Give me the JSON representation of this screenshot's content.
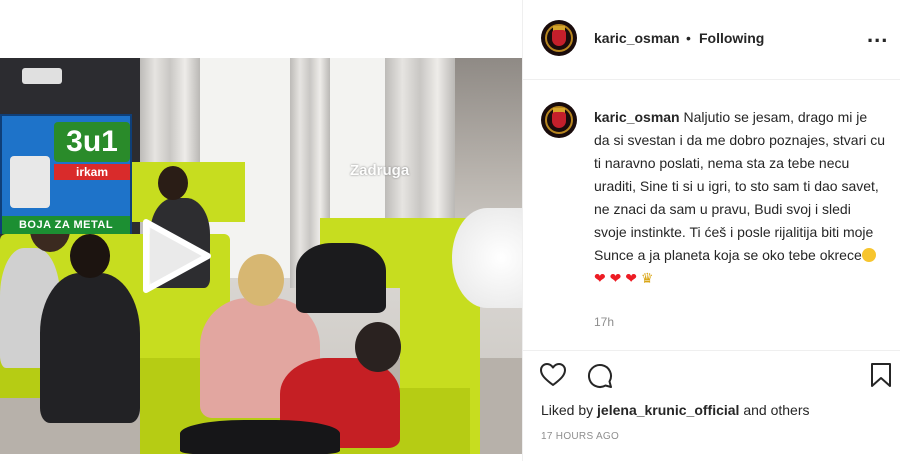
{
  "post": {
    "video": {
      "watermark": "Zadruga",
      "ad_logo_big": "3u1",
      "ad_logo_small": "irkam",
      "ad_band": "BOJA ZA METAL"
    },
    "header": {
      "username": "karic_osman",
      "separator": "•",
      "follow_state": "Following",
      "more_label": "..."
    },
    "comment": {
      "username": "karic_osman",
      "body": "Naljutio se jesam, drago mi je da si svestan i da me dobro poznajes, stvari cu ti naravno poslati, nema sta za tebe necu uraditi, Sine ti si u igri, to sto sam ti dao savet, ne znaci da sam u pravu, Budi svoj i sledi svoje instinkte. Ti ćeš i posle rijalitija biti moje Sunce a ja planeta koja se oko tebe okrece",
      "emojis": [
        "smiling-face-with-heart-eyes",
        "red-heart",
        "red-heart",
        "red-heart",
        "crown"
      ],
      "time_ago": "17h"
    },
    "actions": {
      "icons": [
        "heart-icon",
        "comment-icon",
        "bookmark-icon"
      ]
    },
    "likes": {
      "prefix": "Liked by",
      "user": "jelena_krunic_official",
      "suffix": "and others"
    },
    "posted_ago": "17 HOURS AGO",
    "colors": {
      "text": "#262626",
      "muted": "#8e8e8e",
      "border": "#efefef",
      "sofa": "#c7dd1f"
    }
  }
}
